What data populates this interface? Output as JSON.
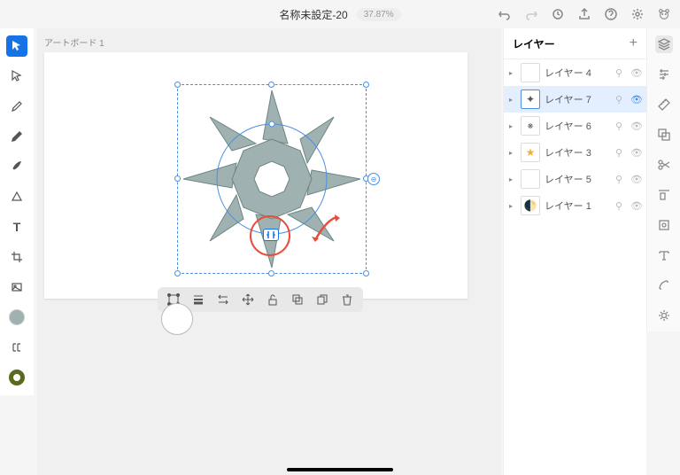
{
  "header": {
    "title": "名称未設定-20",
    "zoom": "37.87%"
  },
  "artboard": {
    "label": "アートボード 1"
  },
  "panel": {
    "title": "レイヤー"
  },
  "layers": [
    {
      "name": "レイヤー 4"
    },
    {
      "name": "レイヤー 7"
    },
    {
      "name": "レイヤー 6"
    },
    {
      "name": "レイヤー 3"
    },
    {
      "name": "レイヤー 5"
    },
    {
      "name": "レイヤー 1"
    }
  ]
}
